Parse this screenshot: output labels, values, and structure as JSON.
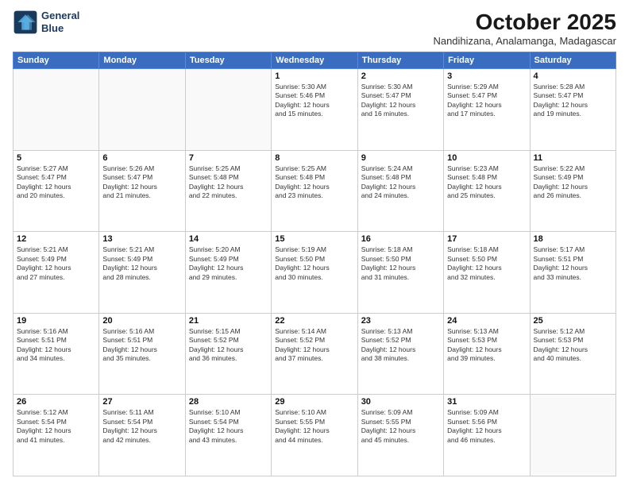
{
  "logo": {
    "line1": "General",
    "line2": "Blue"
  },
  "header": {
    "month": "October 2025",
    "location": "Nandihizana, Analamanga, Madagascar"
  },
  "weekdays": [
    "Sunday",
    "Monday",
    "Tuesday",
    "Wednesday",
    "Thursday",
    "Friday",
    "Saturday"
  ],
  "weeks": [
    [
      {
        "day": "",
        "info": ""
      },
      {
        "day": "",
        "info": ""
      },
      {
        "day": "",
        "info": ""
      },
      {
        "day": "1",
        "info": "Sunrise: 5:30 AM\nSunset: 5:46 PM\nDaylight: 12 hours\nand 15 minutes."
      },
      {
        "day": "2",
        "info": "Sunrise: 5:30 AM\nSunset: 5:47 PM\nDaylight: 12 hours\nand 16 minutes."
      },
      {
        "day": "3",
        "info": "Sunrise: 5:29 AM\nSunset: 5:47 PM\nDaylight: 12 hours\nand 17 minutes."
      },
      {
        "day": "4",
        "info": "Sunrise: 5:28 AM\nSunset: 5:47 PM\nDaylight: 12 hours\nand 19 minutes."
      }
    ],
    [
      {
        "day": "5",
        "info": "Sunrise: 5:27 AM\nSunset: 5:47 PM\nDaylight: 12 hours\nand 20 minutes."
      },
      {
        "day": "6",
        "info": "Sunrise: 5:26 AM\nSunset: 5:47 PM\nDaylight: 12 hours\nand 21 minutes."
      },
      {
        "day": "7",
        "info": "Sunrise: 5:25 AM\nSunset: 5:48 PM\nDaylight: 12 hours\nand 22 minutes."
      },
      {
        "day": "8",
        "info": "Sunrise: 5:25 AM\nSunset: 5:48 PM\nDaylight: 12 hours\nand 23 minutes."
      },
      {
        "day": "9",
        "info": "Sunrise: 5:24 AM\nSunset: 5:48 PM\nDaylight: 12 hours\nand 24 minutes."
      },
      {
        "day": "10",
        "info": "Sunrise: 5:23 AM\nSunset: 5:48 PM\nDaylight: 12 hours\nand 25 minutes."
      },
      {
        "day": "11",
        "info": "Sunrise: 5:22 AM\nSunset: 5:49 PM\nDaylight: 12 hours\nand 26 minutes."
      }
    ],
    [
      {
        "day": "12",
        "info": "Sunrise: 5:21 AM\nSunset: 5:49 PM\nDaylight: 12 hours\nand 27 minutes."
      },
      {
        "day": "13",
        "info": "Sunrise: 5:21 AM\nSunset: 5:49 PM\nDaylight: 12 hours\nand 28 minutes."
      },
      {
        "day": "14",
        "info": "Sunrise: 5:20 AM\nSunset: 5:49 PM\nDaylight: 12 hours\nand 29 minutes."
      },
      {
        "day": "15",
        "info": "Sunrise: 5:19 AM\nSunset: 5:50 PM\nDaylight: 12 hours\nand 30 minutes."
      },
      {
        "day": "16",
        "info": "Sunrise: 5:18 AM\nSunset: 5:50 PM\nDaylight: 12 hours\nand 31 minutes."
      },
      {
        "day": "17",
        "info": "Sunrise: 5:18 AM\nSunset: 5:50 PM\nDaylight: 12 hours\nand 32 minutes."
      },
      {
        "day": "18",
        "info": "Sunrise: 5:17 AM\nSunset: 5:51 PM\nDaylight: 12 hours\nand 33 minutes."
      }
    ],
    [
      {
        "day": "19",
        "info": "Sunrise: 5:16 AM\nSunset: 5:51 PM\nDaylight: 12 hours\nand 34 minutes."
      },
      {
        "day": "20",
        "info": "Sunrise: 5:16 AM\nSunset: 5:51 PM\nDaylight: 12 hours\nand 35 minutes."
      },
      {
        "day": "21",
        "info": "Sunrise: 5:15 AM\nSunset: 5:52 PM\nDaylight: 12 hours\nand 36 minutes."
      },
      {
        "day": "22",
        "info": "Sunrise: 5:14 AM\nSunset: 5:52 PM\nDaylight: 12 hours\nand 37 minutes."
      },
      {
        "day": "23",
        "info": "Sunrise: 5:13 AM\nSunset: 5:52 PM\nDaylight: 12 hours\nand 38 minutes."
      },
      {
        "day": "24",
        "info": "Sunrise: 5:13 AM\nSunset: 5:53 PM\nDaylight: 12 hours\nand 39 minutes."
      },
      {
        "day": "25",
        "info": "Sunrise: 5:12 AM\nSunset: 5:53 PM\nDaylight: 12 hours\nand 40 minutes."
      }
    ],
    [
      {
        "day": "26",
        "info": "Sunrise: 5:12 AM\nSunset: 5:54 PM\nDaylight: 12 hours\nand 41 minutes."
      },
      {
        "day": "27",
        "info": "Sunrise: 5:11 AM\nSunset: 5:54 PM\nDaylight: 12 hours\nand 42 minutes."
      },
      {
        "day": "28",
        "info": "Sunrise: 5:10 AM\nSunset: 5:54 PM\nDaylight: 12 hours\nand 43 minutes."
      },
      {
        "day": "29",
        "info": "Sunrise: 5:10 AM\nSunset: 5:55 PM\nDaylight: 12 hours\nand 44 minutes."
      },
      {
        "day": "30",
        "info": "Sunrise: 5:09 AM\nSunset: 5:55 PM\nDaylight: 12 hours\nand 45 minutes."
      },
      {
        "day": "31",
        "info": "Sunrise: 5:09 AM\nSunset: 5:56 PM\nDaylight: 12 hours\nand 46 minutes."
      },
      {
        "day": "",
        "info": ""
      }
    ]
  ]
}
